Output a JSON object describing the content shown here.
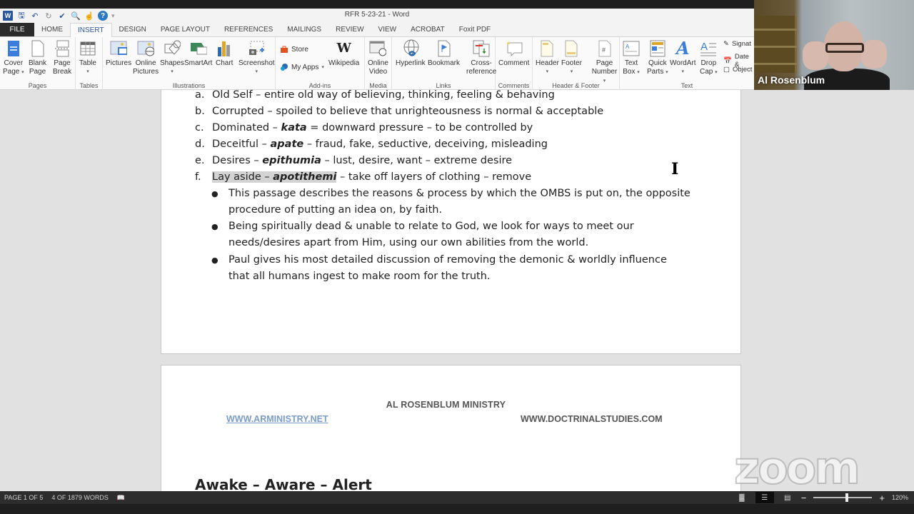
{
  "window": {
    "title": "RFR 5-23-21 - Word"
  },
  "qat": {
    "icons": [
      "word-logo-icon",
      "save-icon",
      "undo-icon",
      "redo-icon",
      "spelling-check-icon",
      "print-preview-icon",
      "touch-mode-icon",
      "help-icon",
      "customize-qat-icon"
    ]
  },
  "tabs": [
    {
      "label": "FILE"
    },
    {
      "label": "HOME"
    },
    {
      "label": "INSERT",
      "active": true
    },
    {
      "label": "DESIGN"
    },
    {
      "label": "PAGE LAYOUT"
    },
    {
      "label": "REFERENCES"
    },
    {
      "label": "MAILINGS"
    },
    {
      "label": "REVIEW"
    },
    {
      "label": "VIEW"
    },
    {
      "label": "ACROBAT"
    },
    {
      "label": "Foxit PDF"
    }
  ],
  "ribbon": {
    "groups": {
      "pages": "Pages",
      "tables": "Tables",
      "illustrations": "Illustrations",
      "addins": "Add-ins",
      "media": "Media",
      "links": "Links",
      "comments": "Comments",
      "header_footer": "Header & Footer",
      "text": "Text"
    },
    "buttons": {
      "cover_page": [
        "Cover",
        "Page"
      ],
      "blank_page": [
        "Blank",
        "Page"
      ],
      "page_break": [
        "Page",
        "Break"
      ],
      "table": "Table",
      "pictures": "Pictures",
      "online_pictures": [
        "Online",
        "Pictures"
      ],
      "shapes": "Shapes",
      "smartart": "SmartArt",
      "chart": "Chart",
      "screenshot": "Screenshot",
      "store": "Store",
      "my_apps": "My Apps",
      "wikipedia": "Wikipedia",
      "online_video": [
        "Online",
        "Video"
      ],
      "hyperlink": "Hyperlink",
      "bookmark": "Bookmark",
      "cross_reference": [
        "Cross-",
        "reference"
      ],
      "comment": "Comment",
      "header": "Header",
      "footer": "Footer",
      "page_number": [
        "Page",
        "Number"
      ],
      "text_box": [
        "Text",
        "Box"
      ],
      "quick_parts": [
        "Quick",
        "Parts"
      ],
      "wordart": "WordArt",
      "drop_cap": [
        "Drop",
        "Cap"
      ],
      "signature": "Signat",
      "date_time": "Date &",
      "object": "Object"
    }
  },
  "document": {
    "page1": {
      "list": [
        {
          "marker": "a.",
          "term": "Old Self",
          "greek": "",
          "rest": " – entire old way of believing, thinking, feeling & behaving"
        },
        {
          "marker": "b.",
          "term": "Corrupted",
          "greek": "",
          "rest": " – spoiled to believe that unrighteousness is normal & acceptable"
        },
        {
          "marker": "c.",
          "term": "Dominated – ",
          "greek": "kata",
          "rest": " = downward pressure – to be controlled by"
        },
        {
          "marker": "d.",
          "term": "Deceitful – ",
          "greek": "apate",
          "rest": " – fraud, fake, seductive, deceiving, misleading"
        },
        {
          "marker": "e.",
          "term": "Desires – ",
          "greek": "epithumia",
          "rest": " – lust, desire, want – extreme desire"
        },
        {
          "marker": "f.",
          "term": "Lay aside – ",
          "greek": "apotithemi",
          "rest": " – take off layers of clothing – remove"
        }
      ],
      "bullets": [
        {
          "line1": "This passage describes the reasons & process by which the OMBS is put on, the opposite",
          "line2": "procedure of putting an idea on, by faith."
        },
        {
          "line1": "Being spiritually dead & unable to relate to God, we look for ways to meet our",
          "line2": "needs/desires apart from Him, using our own abilities from the world."
        },
        {
          "line1": "Paul gives his most detailed discussion of removing the demonic & worldly influence",
          "line2": "that all humans ingest to make room for the truth."
        }
      ]
    },
    "page2": {
      "ministry": "AL ROSENBLUM MINISTRY",
      "link_left": "WWW.ARMINISTRY.NET",
      "link_right": "WWW.DOCTRINALSTUDIES.COM",
      "heading": "Awake – Aware – Alert"
    }
  },
  "statusbar": {
    "page": "PAGE 1 OF 5",
    "words": "4 OF 1879 WORDS",
    "zoom_level": "120%",
    "zoom_percent": 120
  },
  "video": {
    "participant_name": "Al Rosenblum"
  },
  "watermark": {
    "text": "zoom"
  }
}
